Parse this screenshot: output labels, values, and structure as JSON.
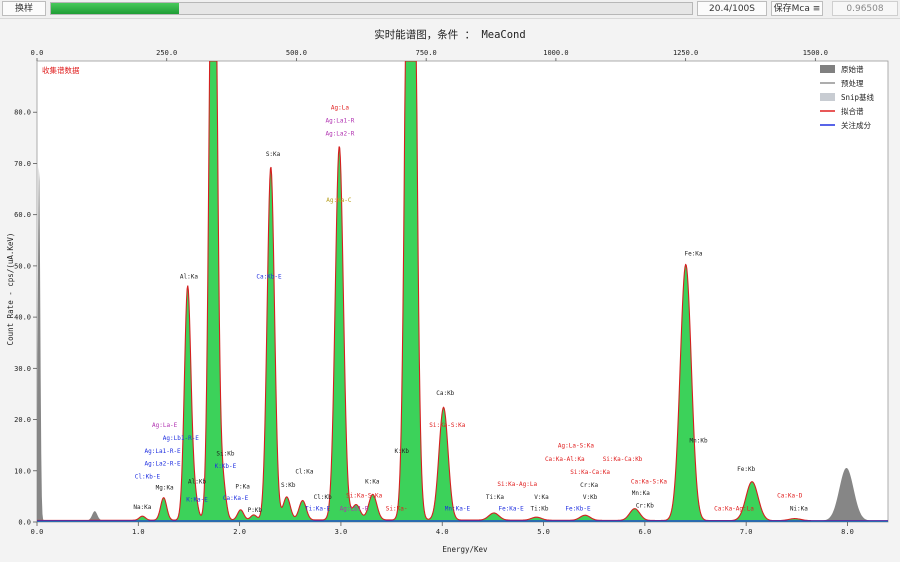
{
  "toolbar": {
    "sample_button": "换样",
    "progress_fraction": 0.2,
    "time_label": "20.4/100S",
    "save_mca_label": "保存Mca ≡",
    "ratio_value": "0.96508"
  },
  "chart_data": {
    "type": "area",
    "title": "实时能谱图，条件 ： MeaCond",
    "xlabel": "Energy/Kev",
    "ylabel": "Count Rate - cps/(uA.KeV)",
    "status_text": "收集谱数据",
    "xlim": [
      0,
      8.4
    ],
    "ylim": [
      0,
      90
    ],
    "x_ticks": [
      "0.0",
      "1.0",
      "2.0",
      "3.0",
      "4.0",
      "5.0",
      "6.0",
      "7.0",
      "8.0"
    ],
    "y_ticks": [
      "0.0",
      "10.0",
      "20.0",
      "30.0",
      "40.0",
      "50.0",
      "60.0",
      "70.0",
      "80.0"
    ],
    "top_axis": {
      "range": [
        0,
        1640
      ],
      "ticks": [
        "0.0",
        "250.0",
        "500.0",
        "750.0",
        "1000.0",
        "1250.0",
        "1500.0"
      ]
    },
    "legend": {
      "placement": "top-right",
      "entries": [
        {
          "label": "原始谱",
          "color": "#808080"
        },
        {
          "label": "预处理",
          "color": "#333333"
        },
        {
          "label": "Snip基线",
          "color": "#c8ccd2"
        },
        {
          "label": "拟合谱",
          "color": "#e02020"
        },
        {
          "label": "关注成分",
          "color": "#2030e0"
        }
      ]
    },
    "colors": {
      "fit_fill": "#3cd25a",
      "fit_line": "#d42020",
      "raw": "#808080",
      "component": "#2030e0",
      "plot_bg": "#ffffff"
    },
    "peaks": [
      {
        "e": 0.02,
        "h": 70,
        "w": 0.012,
        "raw": true
      },
      {
        "e": 0.57,
        "h": 1.8,
        "w": 0.025,
        "raw": true
      },
      {
        "e": 7.99,
        "h": 10.3,
        "w": 0.07,
        "raw": true
      },
      {
        "e": 1.04,
        "h": 0.8,
        "w": 0.03
      },
      {
        "e": 1.25,
        "h": 4.4,
        "w": 0.03
      },
      {
        "e": 1.487,
        "h": 45.5,
        "w": 0.032
      },
      {
        "e": 1.557,
        "h": 4.5,
        "w": 0.03
      },
      {
        "e": 1.74,
        "h": 155,
        "w": 0.035
      },
      {
        "e": 1.835,
        "h": 7,
        "w": 0.03
      },
      {
        "e": 2.01,
        "h": 2.0,
        "w": 0.03
      },
      {
        "e": 2.139,
        "h": 1.0,
        "w": 0.03
      },
      {
        "e": 2.308,
        "h": 69,
        "w": 0.036
      },
      {
        "e": 2.465,
        "h": 4.5,
        "w": 0.035
      },
      {
        "e": 2.622,
        "h": 3.8,
        "w": 0.035
      },
      {
        "e": 2.984,
        "h": 73,
        "w": 0.04
      },
      {
        "e": 3.15,
        "h": 3.0,
        "w": 0.04
      },
      {
        "e": 3.314,
        "h": 5.0,
        "w": 0.04
      },
      {
        "e": 3.69,
        "h": 210,
        "w": 0.043
      },
      {
        "e": 4.013,
        "h": 22,
        "w": 0.045
      },
      {
        "e": 4.51,
        "h": 1.4,
        "w": 0.05
      },
      {
        "e": 4.93,
        "h": 0.6,
        "w": 0.05
      },
      {
        "e": 5.41,
        "h": 1.0,
        "w": 0.05
      },
      {
        "e": 5.9,
        "h": 2.3,
        "w": 0.05
      },
      {
        "e": 6.404,
        "h": 50,
        "w": 0.055
      },
      {
        "e": 7.058,
        "h": 7.6,
        "w": 0.06
      },
      {
        "e": 7.48,
        "h": 0.4,
        "w": 0.06
      }
    ],
    "annotations": [
      {
        "text": "Na:Ka",
        "x": 1.04,
        "y": 2.5,
        "color": "#222222"
      },
      {
        "text": "Mg:Ka",
        "x": 1.26,
        "y": 6.3,
        "color": "#222222"
      },
      {
        "text": "Al:Ka",
        "x": 1.5,
        "y": 47.5,
        "color": "#222222"
      },
      {
        "text": "Al:Kb",
        "x": 1.58,
        "y": 7.5,
        "color": "#222222"
      },
      {
        "text": "K:Ka-E",
        "x": 1.58,
        "y": 4.0,
        "color": "#2030e0"
      },
      {
        "text": "Ag:La-E",
        "x": 1.26,
        "y": 18.5,
        "color": "#b030b0"
      },
      {
        "text": "Ag:Lb1-R-E",
        "x": 1.42,
        "y": 16.0,
        "color": "#2030e0"
      },
      {
        "text": "Ag:La1-R-E",
        "x": 1.24,
        "y": 13.5,
        "color": "#2030e0"
      },
      {
        "text": "Ag:La2-R-E",
        "x": 1.24,
        "y": 11.0,
        "color": "#2030e0"
      },
      {
        "text": "Cl:Kb-E",
        "x": 1.09,
        "y": 8.5,
        "color": "#2030e0"
      },
      {
        "text": "Si:Kb",
        "x": 1.86,
        "y": 13.0,
        "color": "#222222"
      },
      {
        "text": "K:Kb-E",
        "x": 1.86,
        "y": 10.5,
        "color": "#2030e0"
      },
      {
        "text": "P:Ka",
        "x": 2.03,
        "y": 6.5,
        "color": "#222222"
      },
      {
        "text": "Ca:Ka-E",
        "x": 1.96,
        "y": 4.3,
        "color": "#2030e0"
      },
      {
        "text": "P:Kb",
        "x": 2.15,
        "y": 2.0,
        "color": "#222222"
      },
      {
        "text": "S:Ka",
        "x": 2.33,
        "y": 71.5,
        "color": "#222222"
      },
      {
        "text": "Ca:Kb-E",
        "x": 2.29,
        "y": 47.5,
        "color": "#2030e0"
      },
      {
        "text": "S:Kb",
        "x": 2.48,
        "y": 6.8,
        "color": "#222222"
      },
      {
        "text": "Cl:Ka",
        "x": 2.64,
        "y": 9.5,
        "color": "#222222"
      },
      {
        "text": "Cl:Kb",
        "x": 2.82,
        "y": 4.5,
        "color": "#222222"
      },
      {
        "text": "Ti:Ka-E",
        "x": 2.77,
        "y": 2.2,
        "color": "#2030e0"
      },
      {
        "text": "Ag:La",
        "x": 2.99,
        "y": 80.5,
        "color": "#e02020"
      },
      {
        "text": "Ag:La1-R",
        "x": 2.99,
        "y": 78.0,
        "color": "#b030b0"
      },
      {
        "text": "Ag:La2-R",
        "x": 2.99,
        "y": 75.5,
        "color": "#b030b0"
      },
      {
        "text": "Ag:Ka-C",
        "x": 2.98,
        "y": 62.5,
        "color": "#b8a020"
      },
      {
        "text": "K:Ka",
        "x": 3.31,
        "y": 7.5,
        "color": "#222222"
      },
      {
        "text": "Si:Ka-S:Ka",
        "x": 3.23,
        "y": 4.8,
        "color": "#e02020"
      },
      {
        "text": "Ag:Lb1-R",
        "x": 3.13,
        "y": 2.2,
        "color": "#b030b0"
      },
      {
        "text": "Si:Ka-",
        "x": 3.55,
        "y": 2.2,
        "color": "#e02020"
      },
      {
        "text": "K:Kb",
        "x": 3.6,
        "y": 13.5,
        "color": "#222222"
      },
      {
        "text": "Ca:Kb",
        "x": 4.03,
        "y": 24.8,
        "color": "#222222"
      },
      {
        "text": "Si:Ka-S:Ka",
        "x": 4.05,
        "y": 18.5,
        "color": "#e02020"
      },
      {
        "text": "Mn:Ka-E",
        "x": 4.15,
        "y": 2.2,
        "color": "#2030e0"
      },
      {
        "text": "Ti:Ka",
        "x": 4.52,
        "y": 4.5,
        "color": "#222222"
      },
      {
        "text": "Si:Ka-Ag:La",
        "x": 4.74,
        "y": 7.0,
        "color": "#e02020"
      },
      {
        "text": "Fe:Ka-E",
        "x": 4.68,
        "y": 2.2,
        "color": "#2030e0"
      },
      {
        "text": "V:Ka",
        "x": 4.98,
        "y": 4.5,
        "color": "#222222"
      },
      {
        "text": "Ti:Kb",
        "x": 4.96,
        "y": 2.2,
        "color": "#222222"
      },
      {
        "text": "Ag:La-S:Ka",
        "x": 5.32,
        "y": 14.5,
        "color": "#e02020"
      },
      {
        "text": "Ca:Ka-Al:Ka",
        "x": 5.21,
        "y": 11.9,
        "color": "#e02020"
      },
      {
        "text": "Si:Ka-Ca:Kb",
        "x": 5.78,
        "y": 11.9,
        "color": "#e02020"
      },
      {
        "text": "Si:Ka-Ca:Ka",
        "x": 5.46,
        "y": 9.4,
        "color": "#e02020"
      },
      {
        "text": "Cr:Ka",
        "x": 5.45,
        "y": 6.8,
        "color": "#222222"
      },
      {
        "text": "V:Kb",
        "x": 5.46,
        "y": 4.5,
        "color": "#222222"
      },
      {
        "text": "Fe:Kb-E",
        "x": 5.34,
        "y": 2.2,
        "color": "#2030e0"
      },
      {
        "text": "Ca:Ka-S:Ka",
        "x": 6.04,
        "y": 7.5,
        "color": "#e02020"
      },
      {
        "text": "Mn:Ka",
        "x": 5.96,
        "y": 5.3,
        "color": "#222222"
      },
      {
        "text": "Cr:Kb",
        "x": 6.0,
        "y": 2.8,
        "color": "#222222"
      },
      {
        "text": "Fe:Ka",
        "x": 6.48,
        "y": 52.0,
        "color": "#222222"
      },
      {
        "text": "Mn:Kb",
        "x": 6.53,
        "y": 15.5,
        "color": "#222222"
      },
      {
        "text": "Ca:Ka-Ag:La",
        "x": 6.88,
        "y": 2.2,
        "color": "#e02020"
      },
      {
        "text": "Fe:Kb",
        "x": 7.0,
        "y": 10.0,
        "color": "#222222"
      },
      {
        "text": "Ca:Ka-D",
        "x": 7.43,
        "y": 4.8,
        "color": "#e02020"
      },
      {
        "text": "Ni:Ka",
        "x": 7.52,
        "y": 2.2,
        "color": "#222222"
      }
    ]
  }
}
